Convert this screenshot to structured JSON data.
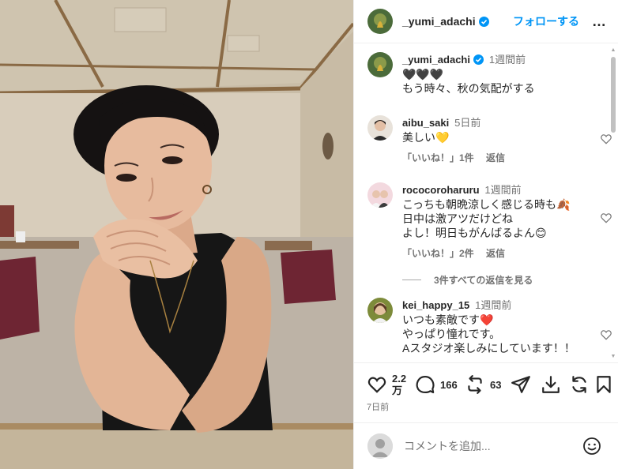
{
  "post": {
    "author": "_yumi_adachi",
    "follow_label": "フォローする",
    "more_label": "…"
  },
  "caption": {
    "author": "_yumi_adachi",
    "time": "1週間前",
    "lines": [
      "🖤🖤🖤",
      "もう時々、秋の気配がする"
    ]
  },
  "comments": [
    {
      "author": "aibu_saki",
      "time": "5日前",
      "lines": [
        "美しい💛"
      ],
      "like_label": "「いいね！」1件",
      "reply_label": "返信"
    },
    {
      "author": "rococoroharuru",
      "time": "1週間前",
      "lines": [
        "こっちも朝晩涼しく感じる時も🍂",
        "日中は激アツだけどね",
        "よし！明日もがんばるよん😊"
      ],
      "like_label": "「いいね！」2件",
      "reply_label": "返信"
    },
    {
      "author": "kei_happy_15",
      "time": "1週間前",
      "lines": [
        "いつも素敵です❤️",
        "やっぱり憧れです。",
        "Aスタジオ楽しみにしています！！"
      ]
    }
  ],
  "view_replies_label": "3件すべての返信を見る",
  "actions": {
    "likes": "2.2万",
    "comments": "166",
    "reposts": "63"
  },
  "date": "7日前",
  "composer": {
    "placeholder": "コメントを追加..."
  },
  "colors": {
    "accent": "#0095f6",
    "verified": "#0095f6",
    "muted": "#737373"
  },
  "icons": [
    "heart-icon",
    "comment-icon",
    "repost-icon",
    "share-icon",
    "download-icon",
    "sync-icon",
    "save-icon",
    "emoji-icon",
    "more-icon",
    "verified-icon"
  ]
}
